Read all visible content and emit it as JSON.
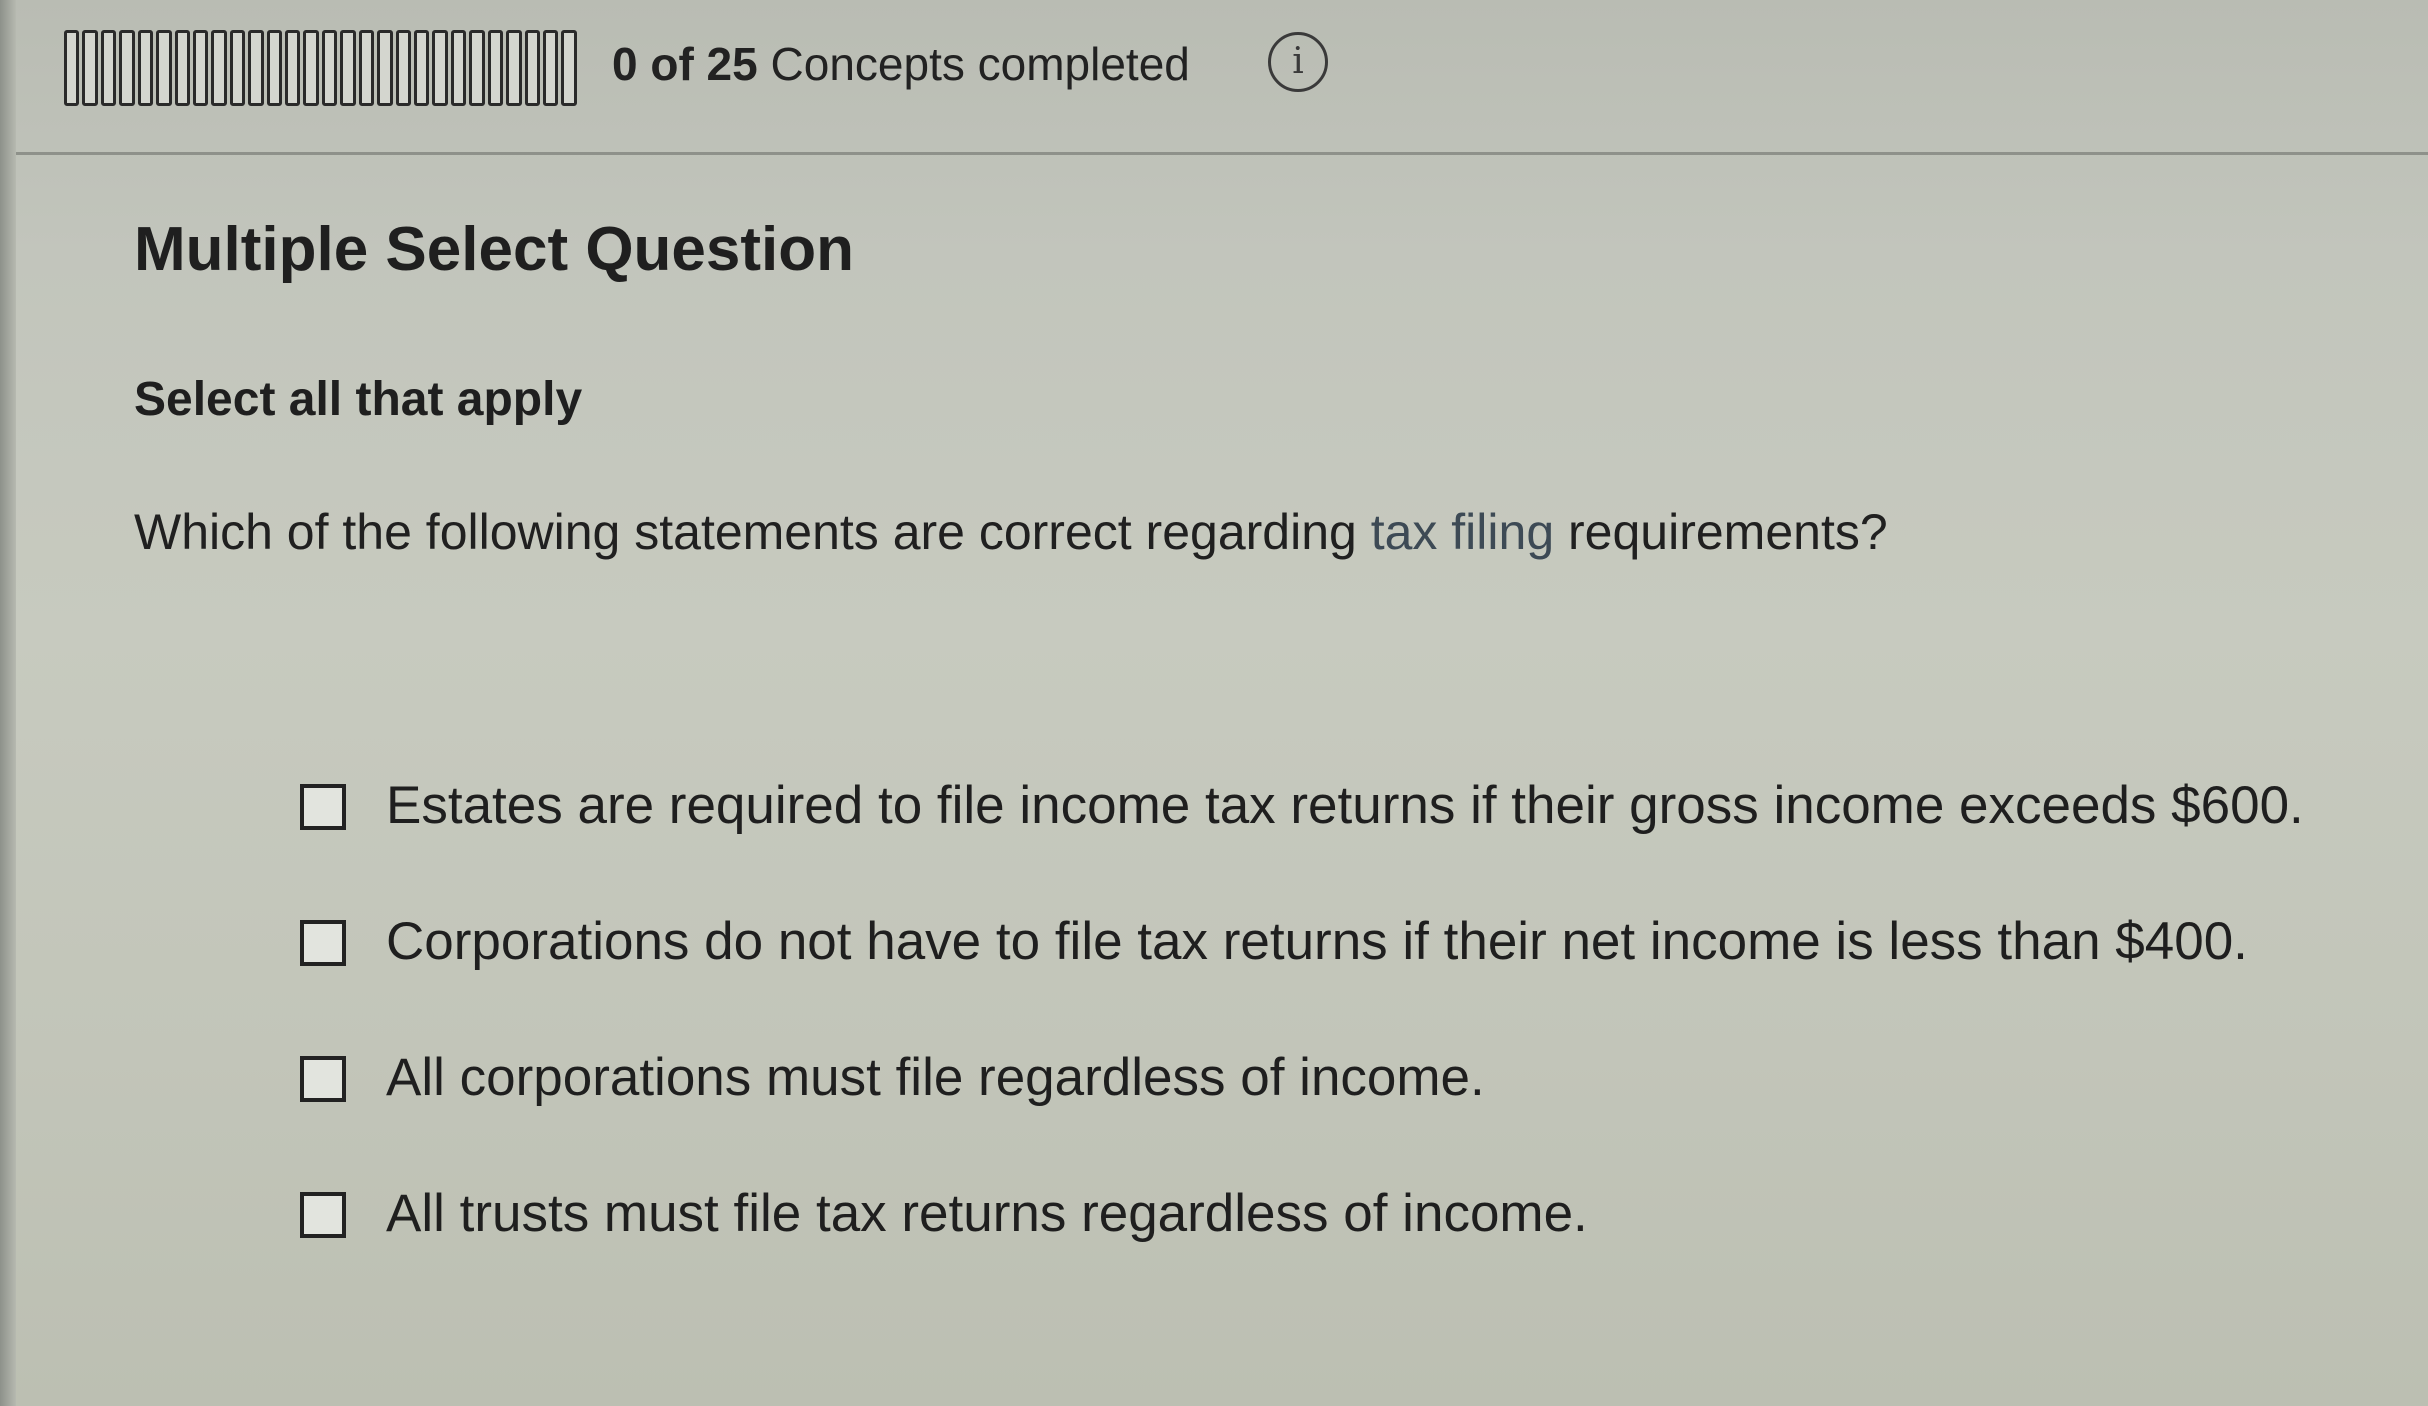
{
  "progress": {
    "completed": 0,
    "total": 25,
    "segments": 28,
    "count_text": "0 of 25",
    "label_text": "Concepts completed",
    "info_icon": "info-icon"
  },
  "question": {
    "type_label": "Multiple Select Question",
    "instruction": "Select all that apply",
    "prompt_before": "Which of the following statements are correct regarding ",
    "prompt_term": "tax filing",
    "prompt_after": " requirements?",
    "options": [
      {
        "label": "Estates are required to file income tax returns if their gross income exceeds $600.",
        "checked": false
      },
      {
        "label": "Corporations do not have to file tax returns if their net income is less than $400.",
        "checked": false
      },
      {
        "label": "All corporations must file regardless of income.",
        "checked": false
      },
      {
        "label": "All trusts must file tax returns regardless of income.",
        "checked": false
      }
    ]
  }
}
